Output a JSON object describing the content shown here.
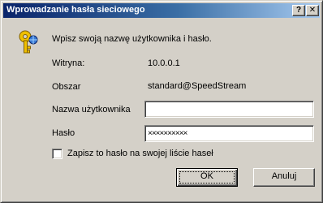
{
  "window": {
    "title": "Wprowadzanie hasła sieciowego",
    "help_glyph": "?",
    "close_glyph": "✕"
  },
  "instruction": "Wpisz swoją nazwę użytkownika i hasło.",
  "fields": {
    "site_label": "Witryna:",
    "site_value": "10.0.0.1",
    "realm_label": "Obszar",
    "realm_value": "standard@SpeedStream",
    "username_label": "Nazwa użytkownika",
    "username_value": "",
    "password_label": "Hasło",
    "password_value": "××××××××××"
  },
  "save_password": {
    "label": "Zapisz to hasło na swojej liście haseł",
    "checked": false
  },
  "buttons": {
    "ok": "OK",
    "cancel": "Anuluj"
  },
  "icons": {
    "key": "key-icon"
  },
  "colors": {
    "titlebar_start": "#0a246a",
    "titlebar_end": "#a6caf0",
    "face": "#d4d0c8"
  }
}
